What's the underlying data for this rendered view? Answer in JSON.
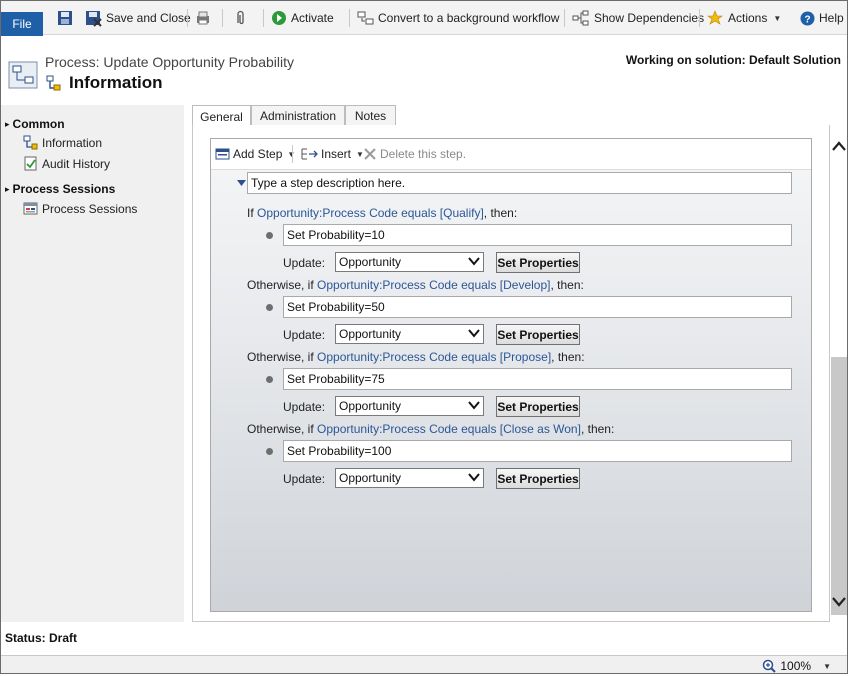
{
  "ribbon": {
    "file": "File",
    "save_and_close": "Save and Close",
    "activate": "Activate",
    "convert": "Convert to a background workflow",
    "show_dependencies": "Show Dependencies",
    "actions": "Actions",
    "help": "Help"
  },
  "header": {
    "process_title": "Process: Update Opportunity Probability",
    "section_title": "Information",
    "solution": "Working on solution: Default Solution"
  },
  "leftnav": {
    "common": "Common",
    "information": "Information",
    "audit_history": "Audit History",
    "process_sessions_head": "Process Sessions",
    "process_sessions": "Process Sessions"
  },
  "tabs": [
    "General",
    "Administration",
    "Notes"
  ],
  "designer": {
    "add_step": "Add Step",
    "insert": "Insert",
    "delete_step": "Delete this step.",
    "description_placeholder": "Type a step description here.",
    "update_label": "Update:",
    "set_properties": "Set Properties",
    "branches": [
      {
        "prefix": "If ",
        "condition": "Opportunity:Process Code equals [Qualify]",
        "suffix": ", then:",
        "action": "Set Probability=10",
        "entity": "Opportunity"
      },
      {
        "prefix": "Otherwise, if ",
        "condition": "Opportunity:Process Code equals [Develop]",
        "suffix": ", then:",
        "action": "Set Probability=50",
        "entity": "Opportunity"
      },
      {
        "prefix": "Otherwise, if ",
        "condition": "Opportunity:Process Code equals [Propose]",
        "suffix": ", then:",
        "action": "Set Probability=75",
        "entity": "Opportunity"
      },
      {
        "prefix": "Otherwise, if ",
        "condition": "Opportunity:Process Code equals [Close as Won]",
        "suffix": ", then:",
        "action": "Set Probability=100",
        "entity": "Opportunity"
      }
    ]
  },
  "status": "Status: Draft",
  "zoom": "100%"
}
